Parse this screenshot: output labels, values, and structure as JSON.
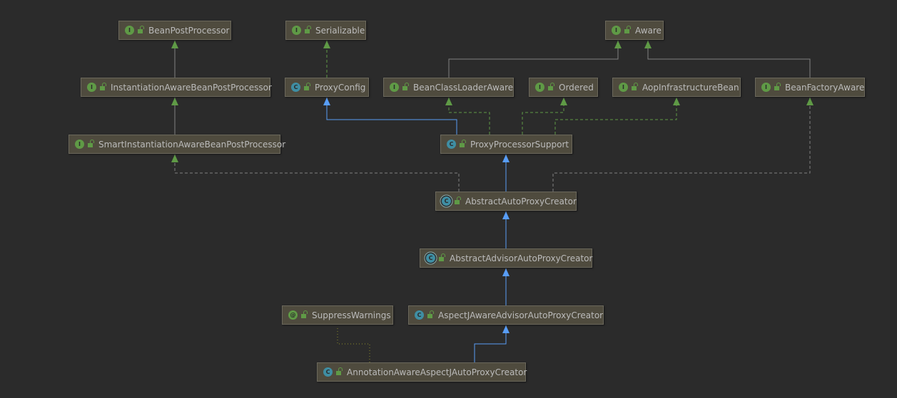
{
  "diagram": {
    "nodes": [
      {
        "name": "BeanPostProcessor",
        "kind": "interface",
        "icon_letter": "I"
      },
      {
        "name": "Serializable",
        "kind": "interface",
        "icon_letter": "I"
      },
      {
        "name": "Aware",
        "kind": "interface",
        "icon_letter": "I"
      },
      {
        "name": "InstantiationAwareBeanPostProcessor",
        "kind": "interface",
        "icon_letter": "I"
      },
      {
        "name": "ProxyConfig",
        "kind": "class",
        "icon_letter": "C"
      },
      {
        "name": "BeanClassLoaderAware",
        "kind": "interface",
        "icon_letter": "I"
      },
      {
        "name": "Ordered",
        "kind": "interface",
        "icon_letter": "I"
      },
      {
        "name": "AopInfrastructureBean",
        "kind": "interface",
        "icon_letter": "I"
      },
      {
        "name": "BeanFactoryAware",
        "kind": "interface",
        "icon_letter": "I"
      },
      {
        "name": "SmartInstantiationAwareBeanPostProcessor",
        "kind": "interface",
        "icon_letter": "I"
      },
      {
        "name": "ProxyProcessorSupport",
        "kind": "class",
        "icon_letter": "C"
      },
      {
        "name": "AbstractAutoProxyCreator",
        "kind": "abstract",
        "icon_letter": "C"
      },
      {
        "name": "AbstractAdvisorAutoProxyCreator",
        "kind": "abstract",
        "icon_letter": "C"
      },
      {
        "name": "SuppressWarnings",
        "kind": "annotation",
        "icon_letter": "@"
      },
      {
        "name": "AspectJAwareAdvisorAutoProxyCreator",
        "kind": "class",
        "icon_letter": "C"
      },
      {
        "name": "AnnotationAwareAspectJAutoProxyCreator",
        "kind": "class",
        "icon_letter": "C"
      }
    ],
    "edges": [
      {
        "from": "InstantiationAwareBeanPostProcessor",
        "to": "BeanPostProcessor",
        "type": "interface-extends"
      },
      {
        "from": "SmartInstantiationAwareBeanPostProcessor",
        "to": "InstantiationAwareBeanPostProcessor",
        "type": "interface-extends"
      },
      {
        "from": "ProxyConfig",
        "to": "Serializable",
        "type": "implements"
      },
      {
        "from": "ProxyProcessorSupport",
        "to": "ProxyConfig",
        "type": "extends"
      },
      {
        "from": "ProxyProcessorSupport",
        "to": "BeanClassLoaderAware",
        "type": "implements"
      },
      {
        "from": "ProxyProcessorSupport",
        "to": "Ordered",
        "type": "implements"
      },
      {
        "from": "ProxyProcessorSupport",
        "to": "AopInfrastructureBean",
        "type": "implements"
      },
      {
        "from": "BeanClassLoaderAware",
        "to": "Aware",
        "type": "interface-extends"
      },
      {
        "from": "BeanFactoryAware",
        "to": "Aware",
        "type": "interface-extends"
      },
      {
        "from": "AbstractAutoProxyCreator",
        "to": "ProxyProcessorSupport",
        "type": "extends"
      },
      {
        "from": "AbstractAutoProxyCreator",
        "to": "SmartInstantiationAwareBeanPostProcessor",
        "type": "implements-gray"
      },
      {
        "from": "AbstractAutoProxyCreator",
        "to": "BeanFactoryAware",
        "type": "implements-gray"
      },
      {
        "from": "AbstractAdvisorAutoProxyCreator",
        "to": "AbstractAutoProxyCreator",
        "type": "extends"
      },
      {
        "from": "AspectJAwareAdvisorAutoProxyCreator",
        "to": "AbstractAdvisorAutoProxyCreator",
        "type": "extends"
      },
      {
        "from": "AnnotationAwareAspectJAutoProxyCreator",
        "to": "AspectJAwareAdvisorAutoProxyCreator",
        "type": "extends"
      },
      {
        "from": "AnnotationAwareAspectJAutoProxyCreator",
        "to": "SuppressWarnings",
        "type": "annotated"
      }
    ],
    "colors": {
      "background": "#2b2b2b",
      "node": "#4f4b3e",
      "extends": "#589df6",
      "implements": "#5f9a46",
      "annotated": "#8a8a2a",
      "gray": "#808080"
    }
  }
}
